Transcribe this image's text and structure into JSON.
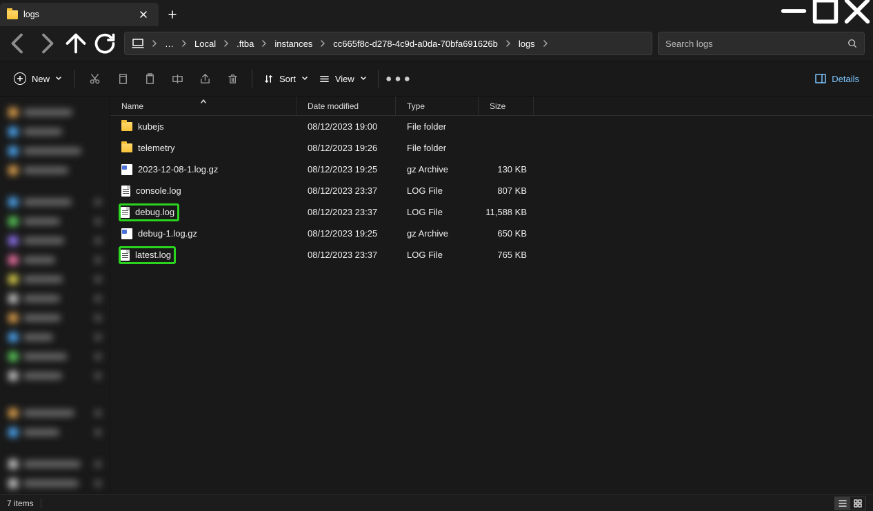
{
  "window": {
    "title": "logs"
  },
  "breadcrumb": [
    "Local",
    ".ftba",
    "instances",
    "cc665f8c-d278-4c9d-a0da-70bfa691626b",
    "logs"
  ],
  "search": {
    "placeholder": "Search logs"
  },
  "toolbar": {
    "new_label": "New",
    "sort_label": "Sort",
    "view_label": "View",
    "details_label": "Details"
  },
  "columns": {
    "name": "Name",
    "date": "Date modified",
    "type": "Type",
    "size": "Size"
  },
  "rows": [
    {
      "icon": "folder",
      "name": "kubejs",
      "date": "08/12/2023 19:00",
      "type": "File folder",
      "size": "",
      "highlight": false
    },
    {
      "icon": "folder",
      "name": "telemetry",
      "date": "08/12/2023 19:26",
      "type": "File folder",
      "size": "",
      "highlight": false
    },
    {
      "icon": "gz",
      "name": "2023-12-08-1.log.gz",
      "date": "08/12/2023 19:25",
      "type": "gz Archive",
      "size": "130 KB",
      "highlight": false
    },
    {
      "icon": "file",
      "name": "console.log",
      "date": "08/12/2023 23:37",
      "type": "LOG File",
      "size": "807 KB",
      "highlight": false
    },
    {
      "icon": "file",
      "name": "debug.log",
      "date": "08/12/2023 23:37",
      "type": "LOG File",
      "size": "11,588 KB",
      "highlight": true
    },
    {
      "icon": "gz",
      "name": "debug-1.log.gz",
      "date": "08/12/2023 19:25",
      "type": "gz Archive",
      "size": "650 KB",
      "highlight": false
    },
    {
      "icon": "file",
      "name": "latest.log",
      "date": "08/12/2023 23:37",
      "type": "LOG File",
      "size": "765 KB",
      "highlight": true
    }
  ],
  "status": {
    "item_count": "7 items"
  }
}
